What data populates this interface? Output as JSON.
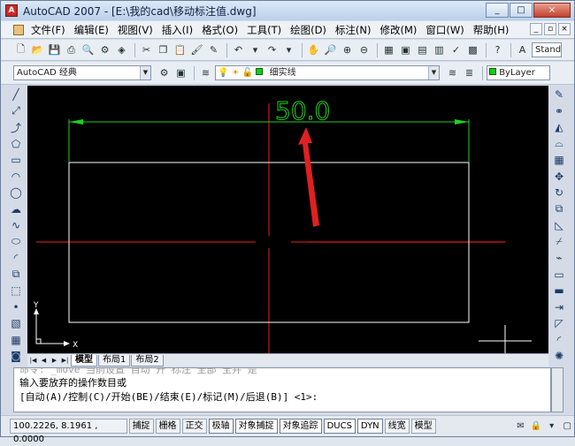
{
  "window": {
    "title": "AutoCAD 2007 - [E:\\我的cad\\移动标注值.dwg]",
    "app_icon_glyph": "A",
    "controls": [
      "_",
      "□",
      "×"
    ]
  },
  "menubar": {
    "items": [
      "文件(F)",
      "编辑(E)",
      "视图(V)",
      "插入(I)",
      "格式(O)",
      "工具(T)",
      "绘图(D)",
      "标注(N)",
      "修改(M)",
      "窗口(W)",
      "帮助(H)"
    ],
    "doc_controls": [
      "_",
      "▫",
      "×"
    ]
  },
  "toolbar1": {
    "style_combo": "Stand"
  },
  "toolbar2": {
    "workspace": "AutoCAD 经典",
    "layer": "细实线",
    "color": "ByLayer"
  },
  "drawing": {
    "dimension_value": "50.0",
    "ucs_y": "Y",
    "ucs_x": "X",
    "colors": {
      "background": "#000000",
      "dimension": "#1ed01e",
      "rectangle": "#ffffff",
      "centerline": "#c01818",
      "annotation_arrow": "#e02020"
    }
  },
  "layout_tabs": {
    "nav": [
      "|◀",
      "◀",
      "▶",
      "▶|"
    ],
    "tabs": [
      "模型",
      "布局1",
      "布局2"
    ],
    "active": "模型"
  },
  "command": {
    "line1": "命令:  _move 当前设置  自动    开  标注    全部  全并    是",
    "line2": "输入要放弃的操作数目或",
    "line3": "[自动(A)/控制(C)/开始(BE)/结束(E)/标记(M)/后退(B)] <1>:"
  },
  "statusbar": {
    "coordinates": "100.2226, 8.1961 , 0.0000",
    "toggles": [
      "捕捉",
      "栅格",
      "正交",
      "极轴",
      "对象捕捉",
      "对象追踪",
      "DUCS",
      "DYN",
      "线宽",
      "模型"
    ]
  }
}
